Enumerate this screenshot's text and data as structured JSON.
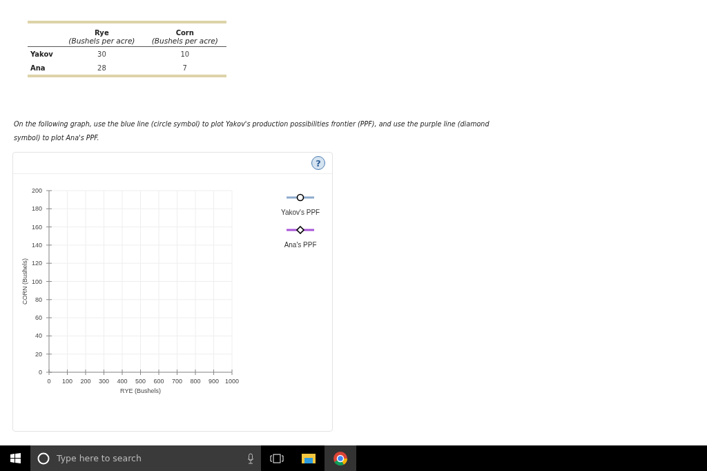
{
  "table": {
    "columns": [
      {
        "label": "Rye",
        "sublabel": "(Bushels per acre)"
      },
      {
        "label": "Corn",
        "sublabel": "(Bushels per acre)"
      }
    ],
    "rows": [
      {
        "name": "Yakov",
        "cells": [
          "30",
          "10"
        ]
      },
      {
        "name": "Ana",
        "cells": [
          "28",
          "7"
        ]
      }
    ]
  },
  "instructions": "On the following graph, use the blue line (circle symbol) to plot Yakov's production possibilities frontier (PPF), and use the purple line (diamond symbol) to plot Ana's PPF.",
  "help_button": {
    "label": "?"
  },
  "chart_data": {
    "type": "line",
    "grid": true,
    "xlabel": "RYE (Bushels)",
    "ylabel": "CORN (Bushels)",
    "xlim": [
      0,
      1000
    ],
    "ylim": [
      0,
      200
    ],
    "xticks": [
      0,
      100,
      200,
      300,
      400,
      500,
      600,
      700,
      800,
      900,
      1000
    ],
    "yticks": [
      0,
      20,
      40,
      60,
      80,
      100,
      120,
      140,
      160,
      180,
      200
    ]
  },
  "legend": [
    {
      "label": "Yakov's PPF",
      "color": "#8eaacc",
      "kind": "circle"
    },
    {
      "label": "Ana's PPF",
      "color": "#a855d6",
      "kind": "diamond"
    }
  ],
  "taskbar": {
    "search_placeholder": "Type here to search"
  }
}
